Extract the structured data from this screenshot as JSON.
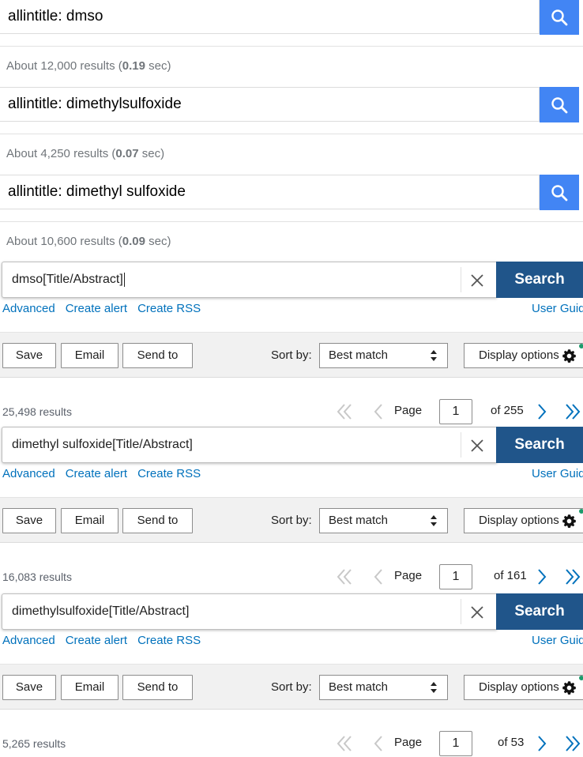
{
  "google": [
    {
      "query": "allintitle: dmso",
      "stats_prefix": "About 12,000 results (",
      "stats_time": "0.19",
      "stats_suffix": " sec)"
    },
    {
      "query": "allintitle: dimethylsulfoxide",
      "stats_prefix": "About 4,250 results (",
      "stats_time": "0.07",
      "stats_suffix": " sec)"
    },
    {
      "query": "allintitle: dimethyl sulfoxide",
      "stats_prefix": "About 10,600 results (",
      "stats_time": "0.09",
      "stats_suffix": " sec)"
    }
  ],
  "pubmed": [
    {
      "query": "dmso[Title/Abstract]",
      "search_label": "Search",
      "links": [
        "Advanced",
        "Create alert",
        "Create RSS"
      ],
      "guide": "User Guid",
      "toolbar": {
        "save": "Save",
        "email": "Email",
        "send_to": "Send to",
        "sort_label": "Sort by:",
        "sort_value": "Best match",
        "display": "Display options"
      },
      "count": "25,498 results",
      "page_label": "Page",
      "page_value": "1",
      "page_total": "of 255"
    },
    {
      "query": "dimethyl sulfoxide[Title/Abstract]",
      "search_label": "Search",
      "links": [
        "Advanced",
        "Create alert",
        "Create RSS"
      ],
      "guide": "User Guid",
      "toolbar": {
        "save": "Save",
        "email": "Email",
        "send_to": "Send to",
        "sort_label": "Sort by:",
        "sort_value": "Best match",
        "display": "Display options"
      },
      "count": "16,083 results",
      "page_label": "Page",
      "page_value": "1",
      "page_total": "of 161"
    },
    {
      "query": "dimethylsulfoxide[Title/Abstract]",
      "search_label": "Search",
      "links": [
        "Advanced",
        "Create alert",
        "Create RSS"
      ],
      "guide": "User Guid",
      "toolbar": {
        "save": "Save",
        "email": "Email",
        "send_to": "Send to",
        "sort_label": "Sort by:",
        "sort_value": "Best match",
        "display": "Display options"
      },
      "count": "5,265 results",
      "page_label": "Page",
      "page_value": "1",
      "page_total": "of 53"
    }
  ],
  "colors": {
    "google_blue": "#4285f4",
    "pubmed_blue": "#20558a",
    "link_blue": "#0071bc",
    "toolbar_bg": "#f1f1f1"
  },
  "icons": {
    "google_search": "magnifier-icon",
    "clear": "close-x-icon",
    "sort": "updown-arrows-icon",
    "display": "gear-icon",
    "first": "double-chevron-left-icon",
    "prev": "chevron-left-icon",
    "next": "chevron-right-icon",
    "last": "double-chevron-right-icon"
  }
}
